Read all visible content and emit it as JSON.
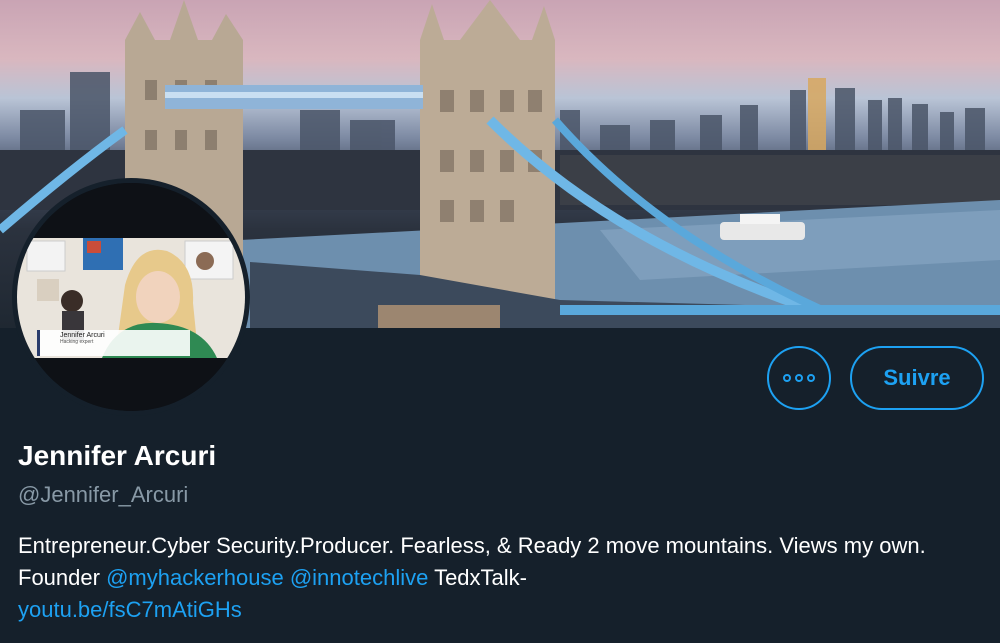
{
  "profile": {
    "display_name": "Jennifer Arcuri",
    "handle": "@Jennifer_Arcuri",
    "bio_text_1": "Entrepreneur.Cyber Security.Producer. Fearless, & Ready 2 move mountains. Views my own. Founder ",
    "mention_1": "@myhackerhouse",
    "mention_2": "@innotechlive",
    "bio_text_2": " TedxTalk-",
    "url": "youtu.be/fsC7mAtiGHs"
  },
  "avatar": {
    "caption_name": "Jennifer Arcuri",
    "caption_sub": "Hacking expert"
  },
  "actions": {
    "more_icon": "more-dots-icon",
    "follow_label": "Suivre"
  },
  "colors": {
    "background": "#15202b",
    "accent": "#1da1f2",
    "secondary_text": "#8899a6"
  }
}
